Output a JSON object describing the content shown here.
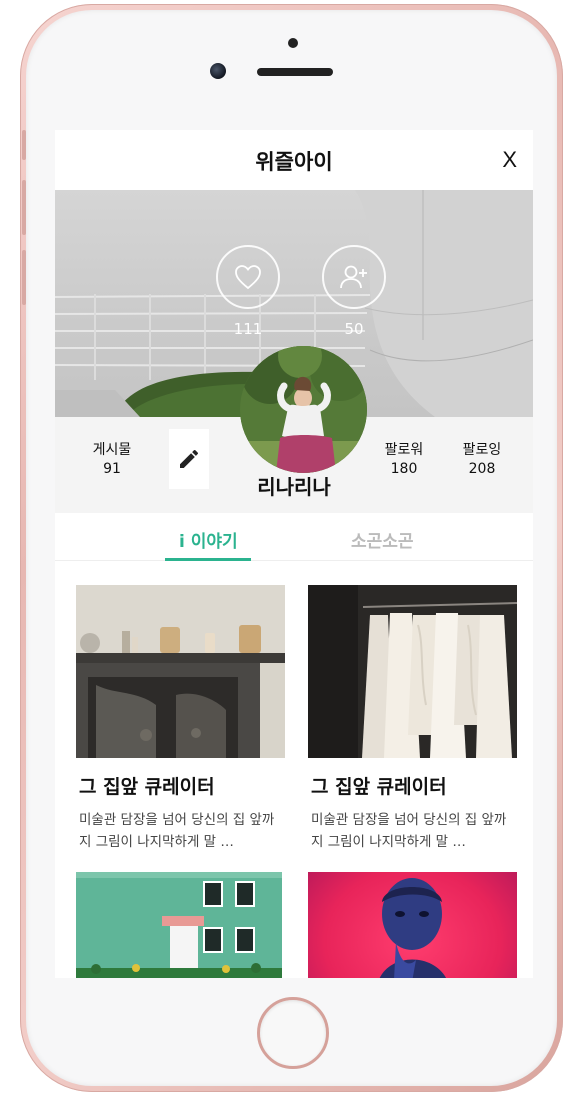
{
  "header": {
    "title": "위즐아이",
    "close_label": "X"
  },
  "profile": {
    "likes_count": "111",
    "followers_icon_count": "50",
    "posts_label": "게시물",
    "posts_count": "91",
    "follower_label": "팔로워",
    "follower_count": "180",
    "following_label": "팔로잉",
    "following_count": "208",
    "username": "리나리나"
  },
  "tabs": [
    {
      "label": "i 이야기",
      "active": true
    },
    {
      "label": "소곤소곤",
      "active": false
    }
  ],
  "cards": [
    {
      "title": "그 집앞 큐레이터",
      "description": "미술관 담장을 넘어 당신의 집 앞까지 그림이 나지막하게 말 …"
    },
    {
      "title": "그 집앞 큐레이터",
      "description": "미술관 담장을 넘어 당신의 집 앞까지 그림이 나지막하게 말 …"
    },
    {
      "title": "",
      "description": ""
    },
    {
      "title": "",
      "description": ""
    }
  ],
  "colors": {
    "accent": "#2bb38f",
    "phone_frame": "#e7b8b2"
  },
  "icons": {
    "like": "heart-icon",
    "follow": "add-user-icon",
    "edit": "pencil-icon",
    "close": "close-icon"
  }
}
